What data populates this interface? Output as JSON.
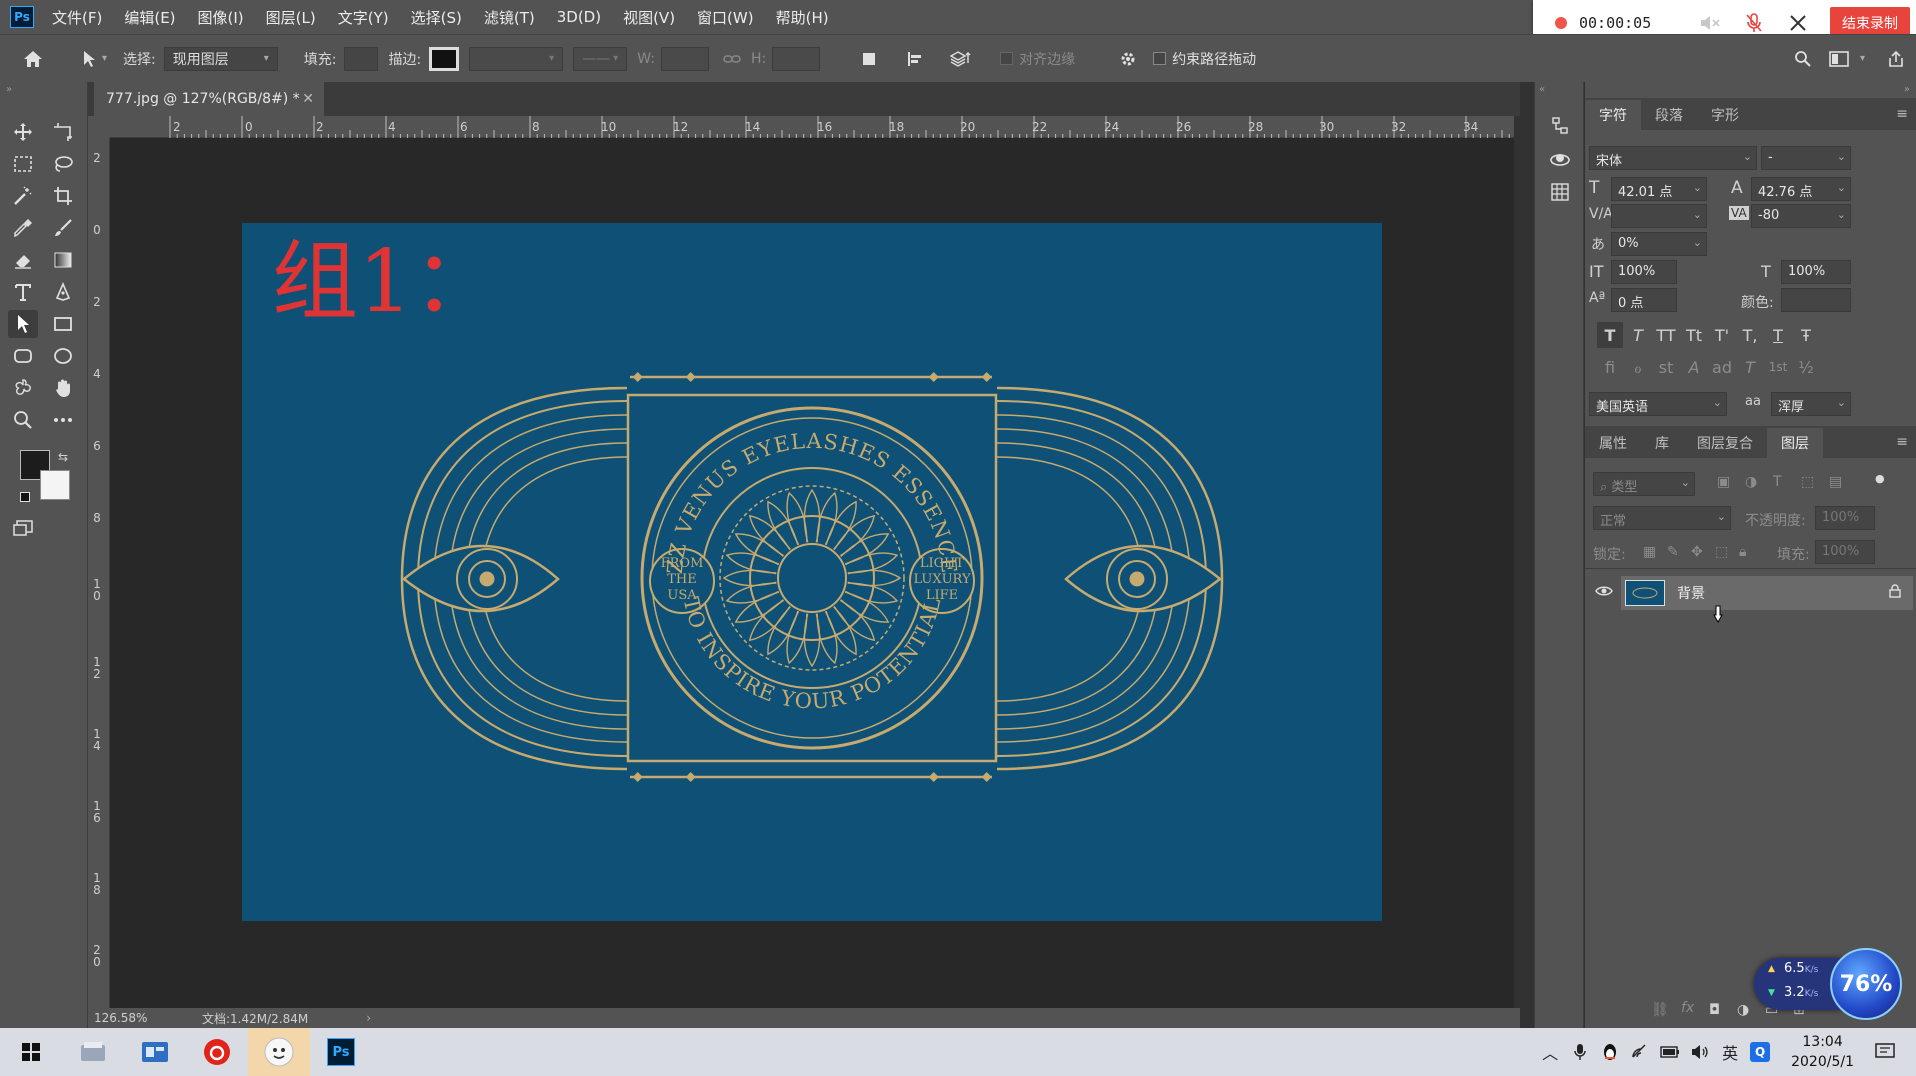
{
  "menubar": {
    "logo": "Ps",
    "items": [
      "文件(F)",
      "编辑(E)",
      "图像(I)",
      "图层(L)",
      "文字(Y)",
      "选择(S)",
      "滤镜(T)",
      "3D(D)",
      "视图(V)",
      "窗口(W)",
      "帮助(H)"
    ]
  },
  "recorder": {
    "time": "00:00:05",
    "stop_label": "结束录制"
  },
  "options": {
    "select_label": "选择:",
    "select_value": "现用图层",
    "fill_label": "填充:",
    "stroke_label": "描边:",
    "w_label": "W:",
    "h_label": "H:",
    "align_edges": "对齐边缘",
    "constrain_path": "约束路径拖动"
  },
  "document": {
    "tab_title": "777.jpg @ 127%(RGB/8#) *",
    "group_label": "组1：",
    "zoom": "126.58%",
    "doc_info": "文档:1.42M/2.84M"
  },
  "rulers": {
    "top": [
      "2",
      "0",
      "2",
      "4",
      "6",
      "8",
      "10",
      "12",
      "14",
      "16",
      "18",
      "20",
      "22",
      "24",
      "26",
      "28",
      "30",
      "32",
      "34"
    ],
    "left": [
      "2",
      "0",
      "2",
      "4",
      "6",
      "8",
      "10",
      "12",
      "14",
      "16",
      "18",
      "20"
    ]
  },
  "logo": {
    "arc_top": "ZZ VENUS EYELASHES ESSENCE",
    "arc_bottom": "TO INSPIRE YOUR POTENTIAL",
    "left_badge": [
      "FROM",
      "THE",
      "USA"
    ],
    "right_badge": [
      "LIGHT",
      "LUXURY",
      "LIFE"
    ]
  },
  "character_panel": {
    "tabs": [
      "字符",
      "段落",
      "字形"
    ],
    "font_family": "宋体",
    "font_style": "-",
    "font_size": "42.01 点",
    "leading": "42.76 点",
    "kerning": "",
    "tracking": "-80",
    "tsume": "0%",
    "vertical_scale": "100%",
    "horizontal_scale": "100%",
    "baseline_shift": "0 点",
    "color_label": "颜色:",
    "language": "美国英语",
    "antialias_label": "aa",
    "antialias": "浑厚",
    "style_buttons": [
      "T",
      "T",
      "TT",
      "Tt",
      "T'",
      "T,",
      "T",
      "Ŧ"
    ],
    "opentype_buttons": [
      "ﬁ",
      "ℴ",
      "st",
      "A",
      "ad",
      "T",
      "1st",
      "½"
    ]
  },
  "layers_panel": {
    "tabs": [
      "属性",
      "库",
      "图层复合",
      "图层"
    ],
    "filter_label": "类型",
    "blend_mode": "正常",
    "opacity_label": "不透明度:",
    "opacity_value": "100%",
    "lock_label": "锁定:",
    "fill_label": "填充:",
    "fill_value": "100%",
    "layers": [
      {
        "name": "背景",
        "visible": true,
        "locked": true
      }
    ],
    "footer_icons": [
      "link-icon",
      "fx-icon",
      "mask-icon",
      "adjustment-icon",
      "folder-icon",
      "new-layer-icon",
      "trash-icon"
    ]
  },
  "speed_widget": {
    "up": "6.5",
    "down": "3.2",
    "unit": "K/s",
    "percent": "76%"
  },
  "taskbar": {
    "clock_time": "13:04",
    "clock_date": "2020/5/1",
    "ime_label": "英"
  },
  "colors": {
    "artboard": "#0f5077",
    "gold": "#c6aa6e",
    "group_label": "#e03434"
  }
}
